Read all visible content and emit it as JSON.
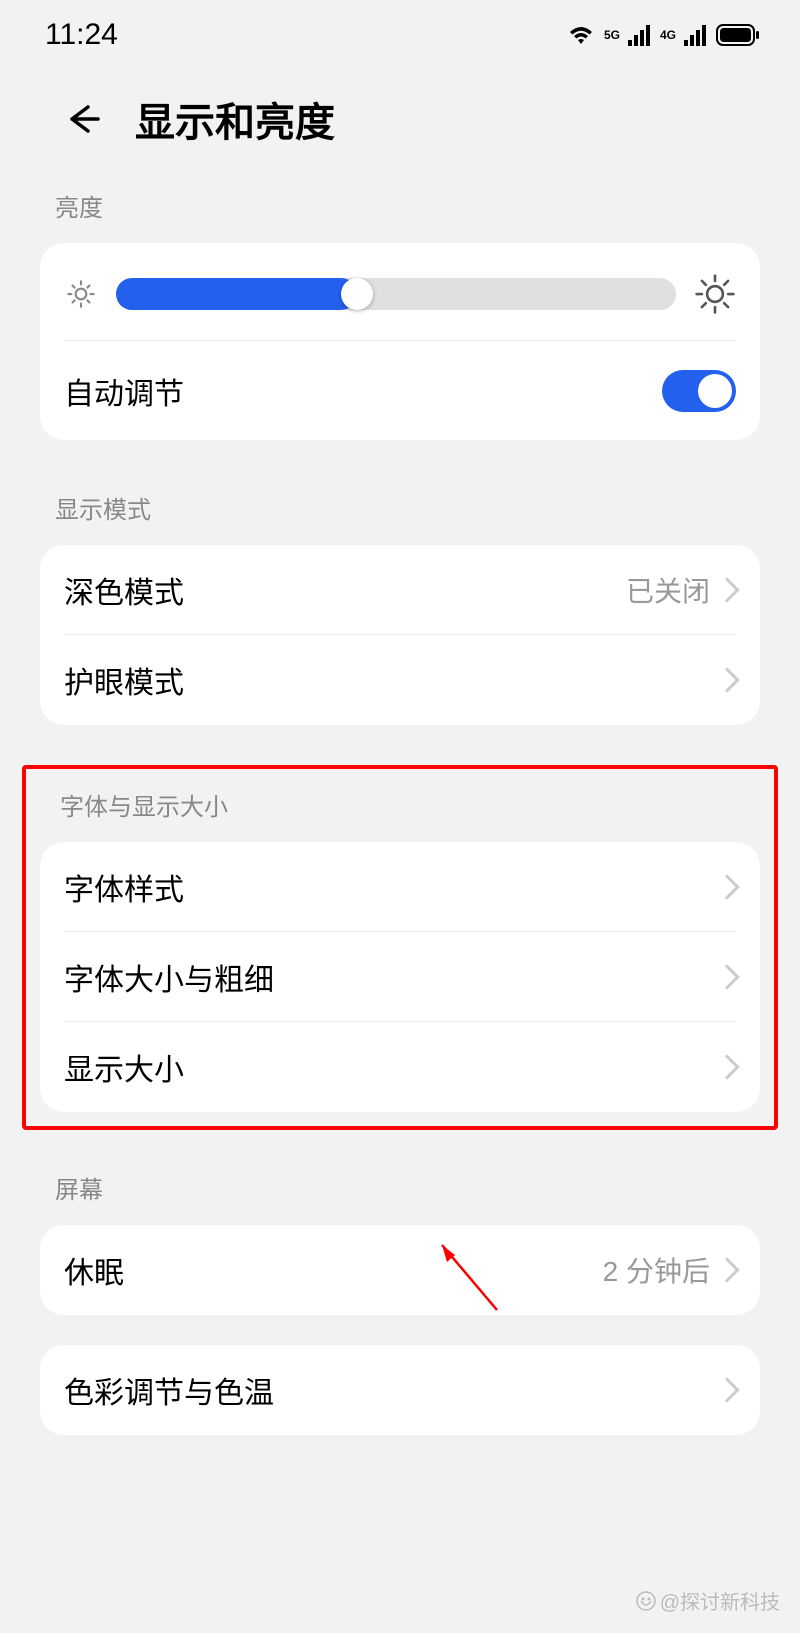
{
  "status": {
    "time": "11:24",
    "net5g": "5G",
    "net4g": "4G"
  },
  "header": {
    "title": "显示和亮度"
  },
  "sections": {
    "brightness": {
      "header": "亮度",
      "auto_label": "自动调节",
      "slider_percent": 43
    },
    "display_mode": {
      "header": "显示模式",
      "dark_mode_label": "深色模式",
      "dark_mode_value": "已关闭",
      "eye_care_label": "护眼模式"
    },
    "font_display": {
      "header": "字体与显示大小",
      "font_style_label": "字体样式",
      "font_size_label": "字体大小与粗细",
      "display_size_label": "显示大小"
    },
    "screen": {
      "header": "屏幕",
      "sleep_label": "休眠",
      "sleep_value": "2 分钟后",
      "color_temp_label": "色彩调节与色温"
    }
  },
  "watermark": "@探讨新科技"
}
